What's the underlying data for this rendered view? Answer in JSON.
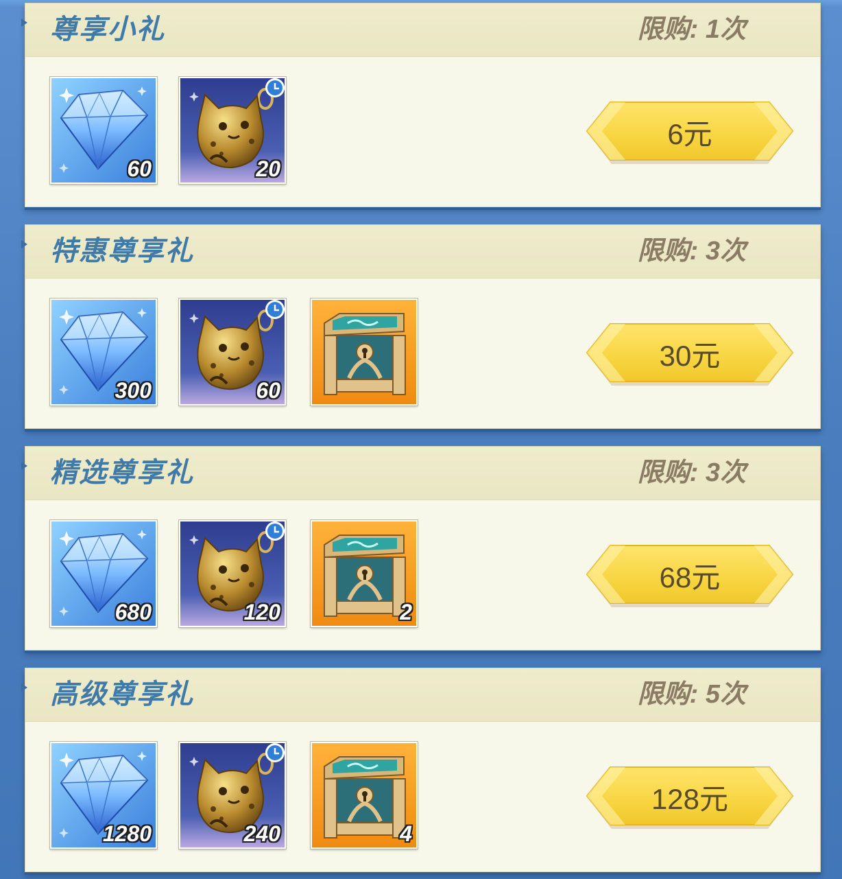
{
  "packages": [
    {
      "title": "尊享小礼",
      "limit": "限购: 1次",
      "price": "6元",
      "items": [
        {
          "icon": "diamond-icon",
          "count": "60"
        },
        {
          "icon": "cat-bell-icon",
          "count": "20",
          "timed": true
        }
      ]
    },
    {
      "title": "特惠尊享礼",
      "limit": "限购: 3次",
      "price": "30元",
      "items": [
        {
          "icon": "diamond-icon",
          "count": "300"
        },
        {
          "icon": "cat-bell-icon",
          "count": "60",
          "timed": true
        },
        {
          "icon": "treasure-chest-icon",
          "count": ""
        }
      ]
    },
    {
      "title": "精选尊享礼",
      "limit": "限购: 3次",
      "price": "68元",
      "items": [
        {
          "icon": "diamond-icon",
          "count": "680"
        },
        {
          "icon": "cat-bell-icon",
          "count": "120",
          "timed": true
        },
        {
          "icon": "treasure-chest-icon",
          "count": "2"
        }
      ]
    },
    {
      "title": "高级尊享礼",
      "limit": "限购: 5次",
      "price": "128元",
      "items": [
        {
          "icon": "diamond-icon",
          "count": "1280"
        },
        {
          "icon": "cat-bell-icon",
          "count": "240",
          "timed": true
        },
        {
          "icon": "treasure-chest-icon",
          "count": "4"
        }
      ]
    }
  ]
}
